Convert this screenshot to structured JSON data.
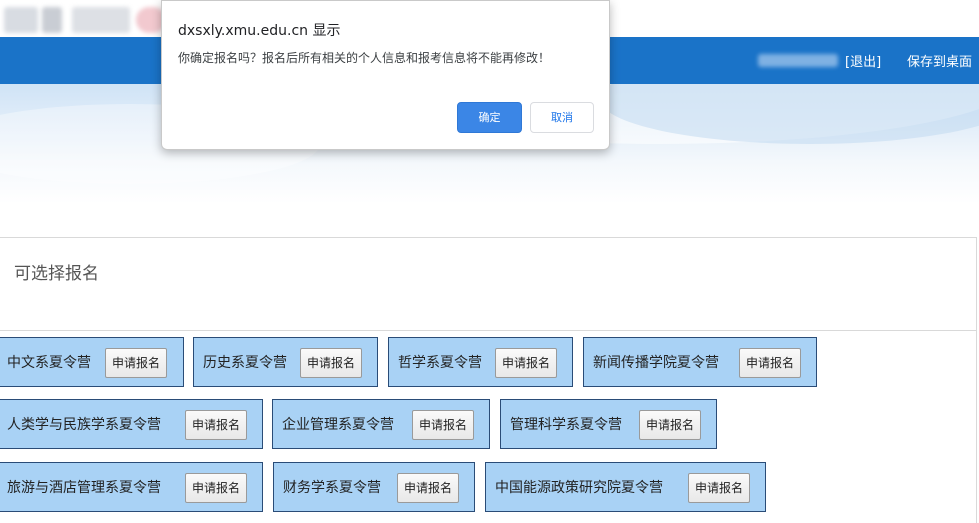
{
  "header": {
    "logout_label": "[退出]",
    "save_to_desktop_label": "保存到桌面"
  },
  "dialog": {
    "title": "dxsxly.xmu.edu.cn 显示",
    "message": "你确定报名吗？报名后所有相关的个人信息和报考信息将不能再修改！",
    "ok_label": "确定",
    "cancel_label": "取消"
  },
  "signup": {
    "title": "可选择报名",
    "apply_label": "申请报名",
    "camps": [
      "中文系夏令营",
      "历史系夏令营",
      "哲学系夏令营",
      "新闻传播学院夏令营",
      "人类学与民族学系夏令营",
      "企业管理系夏令营",
      "管理科学系夏令营",
      "旅游与酒店管理系夏令营",
      "财务学系夏令营",
      "中国能源政策研究院夏令营"
    ]
  },
  "colors": {
    "nav_blue": "#1a73c8",
    "camp_fill": "#a9d2f5",
    "camp_border": "#2a4c77",
    "dialog_ok": "#3b86e6"
  }
}
